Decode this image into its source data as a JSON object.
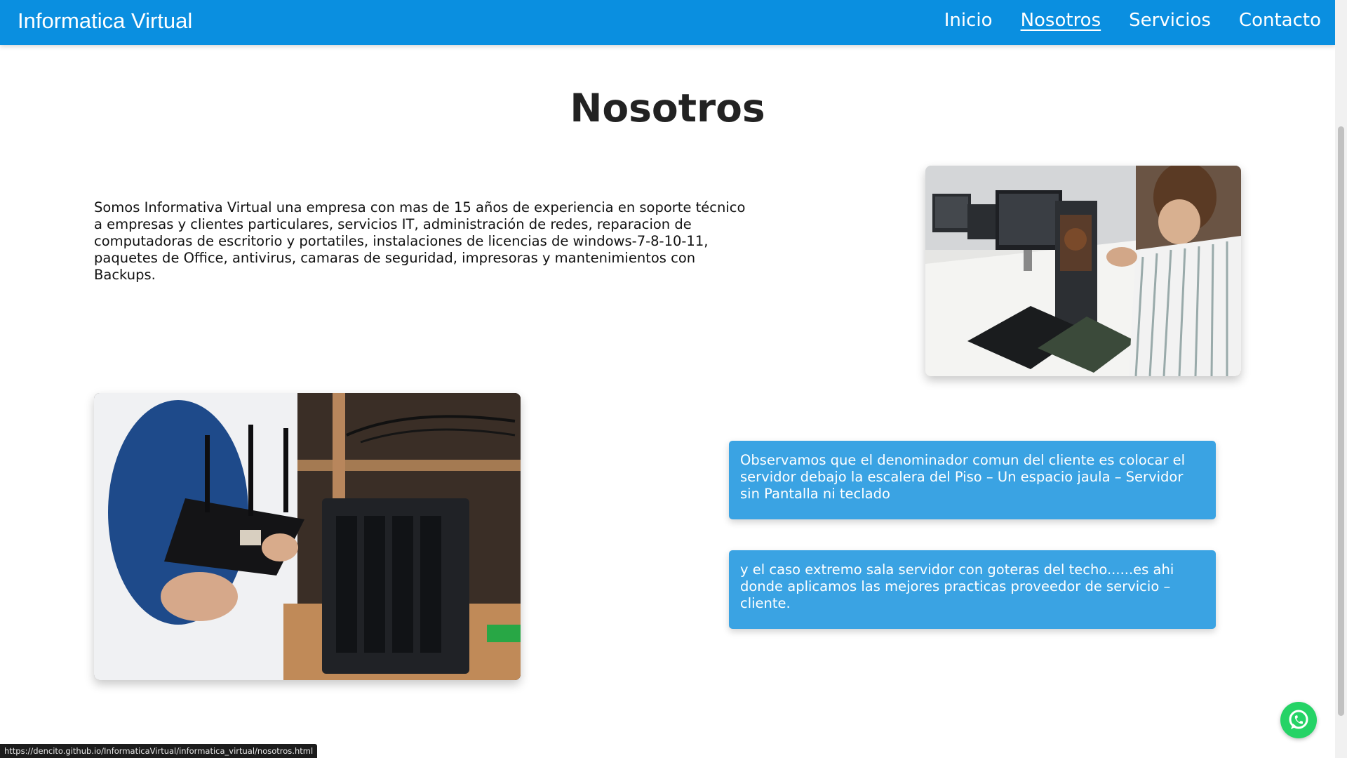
{
  "navbar": {
    "brand": "Informatica Virtual",
    "links": [
      {
        "label": "Inicio",
        "active": false
      },
      {
        "label": "Nosotros",
        "active": true
      },
      {
        "label": "Servicios",
        "active": false
      },
      {
        "label": "Contacto",
        "active": false
      }
    ],
    "background_color": "#0a8fe0"
  },
  "main": {
    "title": "Nosotros",
    "intro": "Somos Informativa Virtual una empresa con mas de 15 años de experiencia en soporte técnico a empresas y clientes particulares, servicios IT, administración de redes, reparacion de computadoras de escritorio y portatiles, instalaciones de licencias de windows-7-8-10-11, paquetes de Office, antivirus, camaras de seguridad, impresoras y mantenimientos con Backups.",
    "cards": [
      {
        "text": "Observamos que el denominador comun del cliente es colocar el servidor debajo la escalera del Piso – Un espacio jaula – Servidor sin Pantalla ni teclado"
      },
      {
        "text": "y el caso extremo sala servidor con goteras del techo......es ahi donde aplicamos las mejores practicas proveedor de servicio – cliente."
      }
    ],
    "card_color": "#3aa3e3"
  },
  "status_bar": {
    "url": "https://dencito.github.io/InformaticaVirtual/informatica_virtual/nosotros.html"
  },
  "icons": {
    "whatsapp": "whatsapp-icon"
  }
}
